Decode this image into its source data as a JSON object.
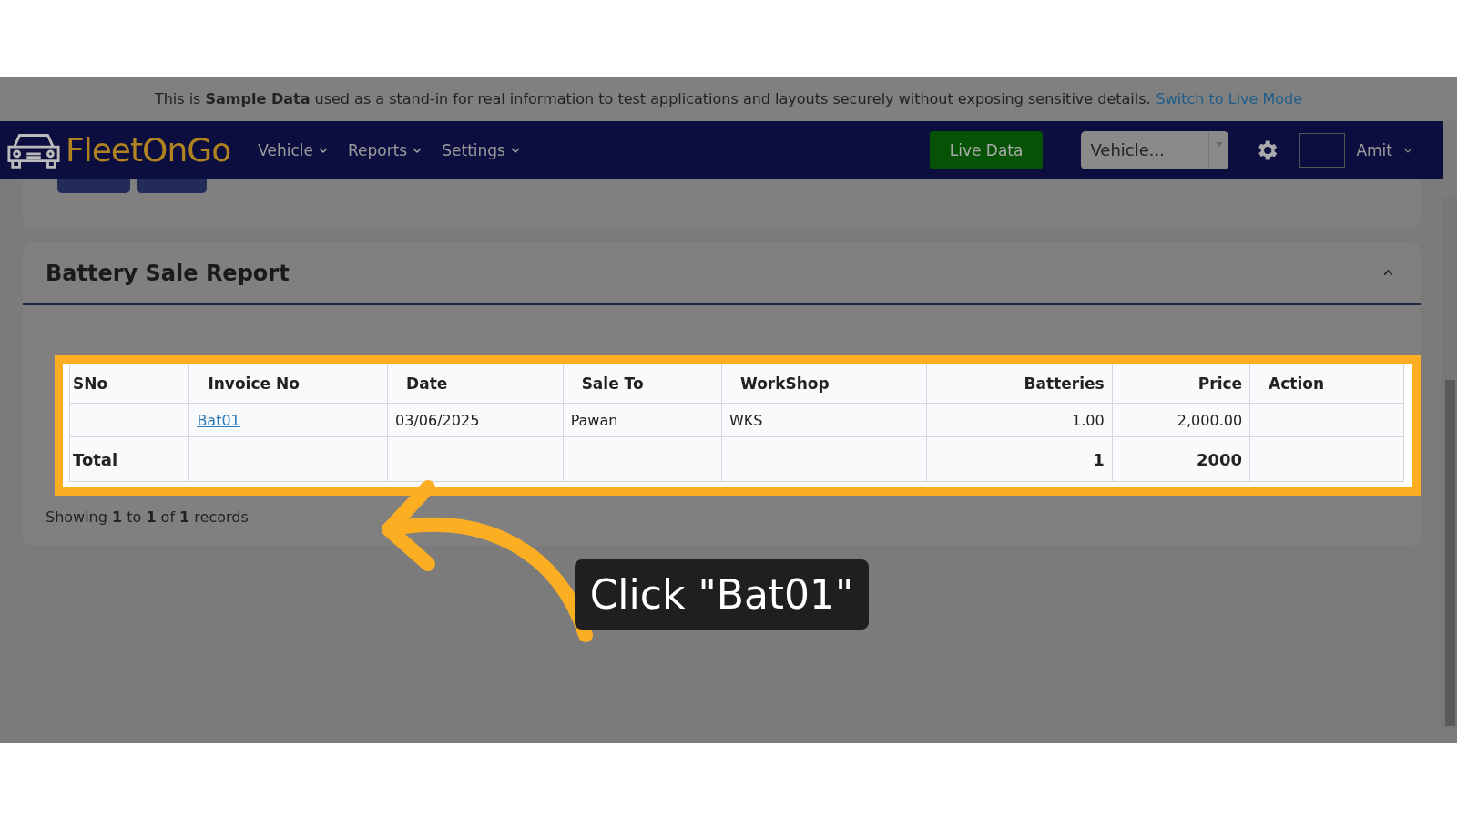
{
  "banner": {
    "text": "This is **Sample Data** used as a stand-in for real information to test applications and layouts securely without exposing sensitive details.",
    "link": "Switch to Live Mode"
  },
  "navbar": {
    "logo": "FleetOnGo",
    "menus": [
      "Vehicle",
      "Reports",
      "Settings"
    ],
    "live_button": "Live Data",
    "vehicle_select": {
      "placeholder": "Vehicle..."
    },
    "user": "Amit"
  },
  "report": {
    "title": "Battery Sale Report",
    "expanded": true,
    "table": {
      "columns": [
        {
          "label": "SNo"
        },
        {
          "label": "Invoice No"
        },
        {
          "label": "Date"
        },
        {
          "label": "Sale To"
        },
        {
          "label": "WorkShop"
        },
        {
          "label": "Batteries"
        },
        {
          "label": "Price"
        },
        {
          "label": "Action"
        }
      ],
      "rows": [
        {
          "invoice": "Bat01",
          "date": "03/06/2025",
          "sale_to": "Pawan",
          "workshop": "WKS",
          "batteries": "1.00",
          "price": "2,000.00"
        }
      ],
      "total": {
        "label": "Total",
        "batteries": "1",
        "price": "2000"
      }
    },
    "footer": "Showing **1** to **1** of **1** records"
  },
  "tooltip": {
    "text": "Click \"Bat01\""
  }
}
